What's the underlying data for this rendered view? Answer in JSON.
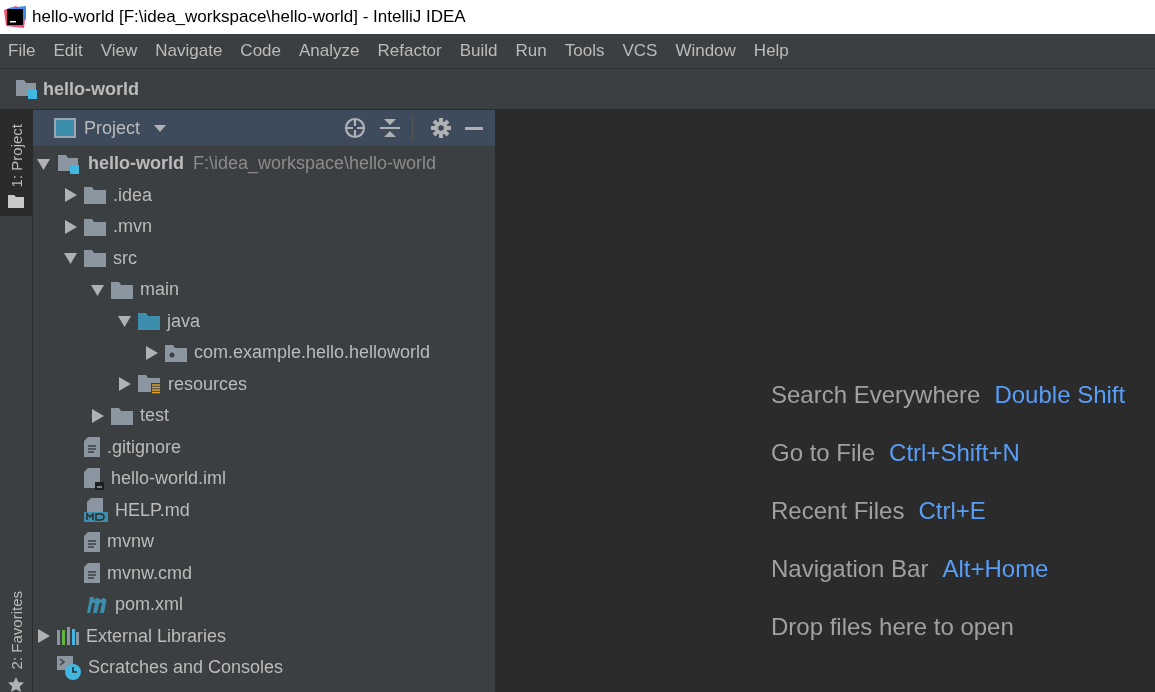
{
  "window": {
    "title": "hello-world [F:\\idea_workspace\\hello-world] - IntelliJ IDEA"
  },
  "menu": [
    "File",
    "Edit",
    "View",
    "Navigate",
    "Code",
    "Analyze",
    "Refactor",
    "Build",
    "Run",
    "Tools",
    "VCS",
    "Window",
    "Help"
  ],
  "nav_bar": {
    "project": "hello-world"
  },
  "side_tabs": [
    {
      "label": "1: Project",
      "selected": true
    },
    {
      "label": "2: Favorites",
      "selected": false
    }
  ],
  "project_panel": {
    "title": "Project",
    "tree": [
      {
        "name": "hello-world",
        "path": "F:\\idea_workspace\\hello-world",
        "kind": "module",
        "expanded": true,
        "children": [
          {
            "name": ".idea",
            "kind": "folder",
            "expanded": false
          },
          {
            "name": ".mvn",
            "kind": "folder",
            "expanded": false
          },
          {
            "name": "src",
            "kind": "folder",
            "expanded": true,
            "children": [
              {
                "name": "main",
                "kind": "folder",
                "expanded": true,
                "children": [
                  {
                    "name": "java",
                    "kind": "source",
                    "expanded": true,
                    "children": [
                      {
                        "name": "com.example.hello.helloworld",
                        "kind": "package",
                        "expanded": false
                      }
                    ]
                  },
                  {
                    "name": "resources",
                    "kind": "resources",
                    "expanded": false
                  }
                ]
              },
              {
                "name": "test",
                "kind": "folder",
                "expanded": false
              }
            ]
          },
          {
            "name": ".gitignore",
            "kind": "file"
          },
          {
            "name": "hello-world.iml",
            "kind": "iml"
          },
          {
            "name": "HELP.md",
            "kind": "md"
          },
          {
            "name": "mvnw",
            "kind": "file"
          },
          {
            "name": "mvnw.cmd",
            "kind": "file"
          },
          {
            "name": "pom.xml",
            "kind": "maven"
          }
        ]
      },
      {
        "name": "External Libraries",
        "kind": "libraries",
        "expanded": false
      },
      {
        "name": "Scratches and Consoles",
        "kind": "scratches"
      }
    ]
  },
  "editor_hints": [
    {
      "label": "Search Everywhere",
      "shortcut": "Double Shift"
    },
    {
      "label": "Go to File",
      "shortcut": "Ctrl+Shift+N"
    },
    {
      "label": "Recent Files",
      "shortcut": "Ctrl+E"
    },
    {
      "label": "Navigation Bar",
      "shortcut": "Alt+Home"
    },
    {
      "label": "Drop files here to open"
    }
  ]
}
